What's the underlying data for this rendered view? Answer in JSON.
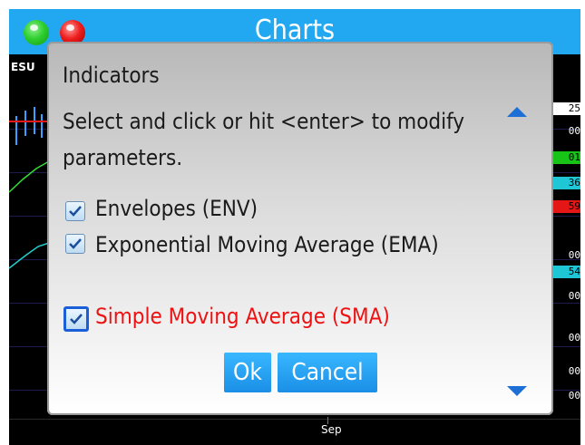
{
  "window": {
    "title": "Charts"
  },
  "chart": {
    "symbol": "ESU",
    "x_axis_label": "Sep",
    "price_tags": [
      {
        "text": "25",
        "color": "white"
      },
      {
        "text": "00",
        "color": "none"
      },
      {
        "text": "01",
        "color": "green"
      },
      {
        "text": "36",
        "color": "cyan"
      },
      {
        "text": "59",
        "color": "red"
      },
      {
        "text": "00",
        "color": "none"
      },
      {
        "text": "54",
        "color": "cyan"
      },
      {
        "text": "00",
        "color": "none"
      },
      {
        "text": "00",
        "color": "none"
      },
      {
        "text": "00",
        "color": "none"
      },
      {
        "text": "00",
        "color": "none"
      }
    ]
  },
  "dialog": {
    "title": "Indicators",
    "instruction": "Select and click or hit <enter> to modify parameters.",
    "items": [
      {
        "label": "Envelopes (ENV)",
        "checked": true,
        "selected": false
      },
      {
        "label": "Exponential Moving Average (EMA)",
        "checked": true,
        "selected": false
      },
      {
        "label": "Simple Moving Average (SMA)",
        "checked": true,
        "selected": true
      }
    ],
    "ok_label": "Ok",
    "cancel_label": "Cancel"
  },
  "colors": {
    "titlebar": "#22a8f0",
    "button": "#1b8fe6",
    "selected_text": "#ee1111",
    "scroll_arrow": "#1d6fd6"
  }
}
